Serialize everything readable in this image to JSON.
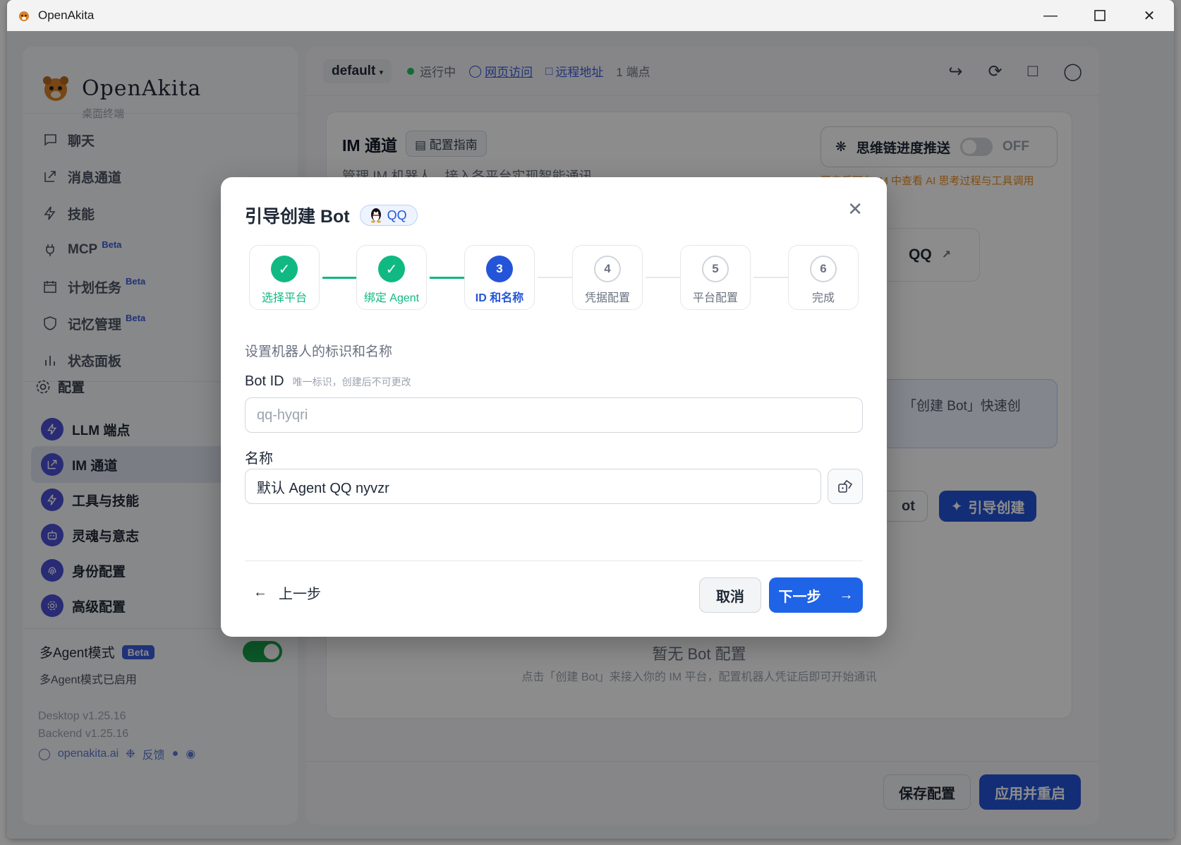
{
  "window": {
    "title": "OpenAkita"
  },
  "sidebar": {
    "brand_name": "OpenAkita",
    "brand_sub": "桌面终端",
    "nav": [
      {
        "label": "聊天",
        "icon": "chat-icon"
      },
      {
        "label": "消息通道",
        "icon": "share-icon"
      },
      {
        "label": "技能",
        "icon": "bolt-icon"
      },
      {
        "label": "MCP",
        "icon": "plug-icon",
        "badge": "Beta"
      },
      {
        "label": "计划任务",
        "icon": "calendar-icon",
        "badge": "Beta"
      },
      {
        "label": "记忆管理",
        "icon": "shield-icon",
        "badge": "Beta"
      },
      {
        "label": "状态面板",
        "icon": "bar-chart-icon"
      }
    ],
    "config_heading": "配置",
    "config_items": [
      {
        "label": "LLM 端点",
        "icon": "bolt-icon"
      },
      {
        "label": "IM 通道",
        "icon": "share-icon",
        "active": true
      },
      {
        "label": "工具与技能",
        "icon": "bolt-icon"
      },
      {
        "label": "灵魂与意志",
        "icon": "robot-icon"
      },
      {
        "label": "身份配置",
        "icon": "fingerprint-icon"
      },
      {
        "label": "高级配置",
        "icon": "gear-icon"
      }
    ],
    "multi_agent_label": "多Agent模式",
    "multi_agent_badge": "Beta",
    "multi_agent_desc": "多Agent模式已启用",
    "multi_agent_enabled": true,
    "desktop_version": "Desktop v1.25.16",
    "backend_version": "Backend v1.25.16",
    "site_link": "openakita.ai",
    "feedback_link": "反馈"
  },
  "topbar": {
    "workspace": "default",
    "status": "运行中",
    "web_access": "网页访问",
    "remote_addr": "远程地址",
    "endpoints": "1 端点"
  },
  "page": {
    "title": "IM 通道",
    "guide_button": "配置指南",
    "subtitle": "管理 IM 机器人，接入各平台实现智能通讯",
    "thought_push_label": "思维链进度推送",
    "thought_push_state": "OFF",
    "thought_push_note": "开启后可在 IM 中查看 AI 思考过程与工具调用",
    "qq_platform": "QQ",
    "info_text": "「创建 Bot」快速创",
    "partial_button": "ot",
    "guide_create_button": "引导创建",
    "empty_title": "暂无 Bot 配置",
    "empty_desc": "点击「创建 Bot」来接入你的 IM 平台，配置机器人凭证后即可开始通讯",
    "save_button": "保存配置",
    "apply_button": "应用并重启"
  },
  "modal": {
    "title": "引导创建 Bot",
    "platform": "QQ",
    "steps": [
      {
        "num": "1",
        "label": "选择平台",
        "state": "done"
      },
      {
        "num": "2",
        "label": "绑定 Agent",
        "state": "done"
      },
      {
        "num": "3",
        "label": "ID 和名称",
        "state": "current"
      },
      {
        "num": "4",
        "label": "凭据配置",
        "state": "todo"
      },
      {
        "num": "5",
        "label": "平台配置",
        "state": "todo"
      },
      {
        "num": "6",
        "label": "完成",
        "state": "todo"
      }
    ],
    "step_description": "设置机器人的标识和名称",
    "bot_id_label": "Bot ID",
    "bot_id_hint": "唯一标识，创建后不可更改",
    "bot_id_placeholder": "qq-hyqri",
    "name_label": "名称",
    "name_value": "默认 Agent QQ nyvzr",
    "prev_button": "上一步",
    "cancel_button": "取消",
    "next_button": "下一步"
  },
  "colors": {
    "accent": "#2455d8",
    "success": "#10b981",
    "warning": "#ea8c1f"
  }
}
